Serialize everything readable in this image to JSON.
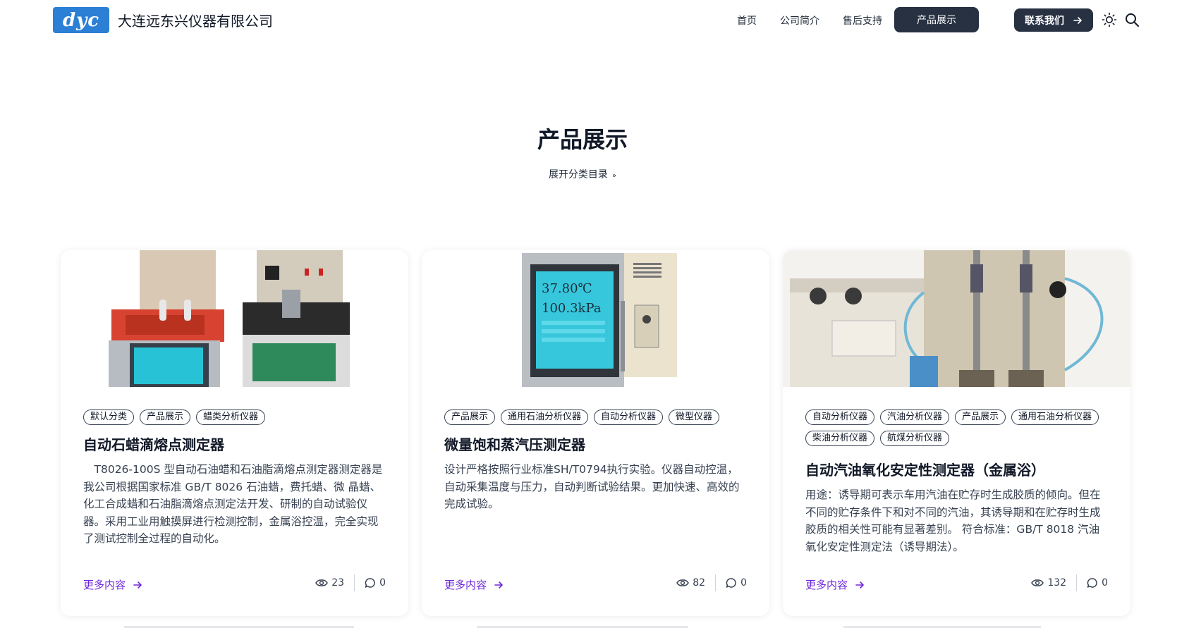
{
  "header": {
    "logo_text": "dyc",
    "site_name": "大连远东兴仪器有限公司",
    "nav": {
      "home": "首页",
      "about": "公司简介",
      "support": "售后支持",
      "products": "产品展示",
      "contact": "联系我们"
    },
    "icons": [
      "arrow-right-icon",
      "sun-icon",
      "search-icon"
    ]
  },
  "main": {
    "title": "产品展示",
    "expand_label": "展开分类目录"
  },
  "cards": [
    {
      "tags": [
        "默认分类",
        "产品展示",
        "蜡类分析仪器"
      ],
      "title": "自动石蜡滴熔点测定器",
      "description": "　T8026-100S 型自动石油蜡和石油脂滴熔点测定器测定器是我公司根据国家标准 GB/T 8026 石油蜡，费托蜡、微 晶蜡、化工合成蜡和石油脂滴熔点测定法开发、研制的自动试验仪器。采用工业用触摸屏进行检测控制，金属浴控温，完全实现了测试控制全过程的自动化。",
      "more": "更多内容",
      "views": "23",
      "comments": "0"
    },
    {
      "tags": [
        "产品展示",
        "通用石油分析仪器",
        "自动分析仪器",
        "微型仪器"
      ],
      "title": "微量饱和蒸汽压测定器",
      "description": "设计严格按照行业标准SH/T0794执行实验。仪器自动控温，自动采集温度与压力，自动判断试验结果。更加快速、高效的完成试验。",
      "more": "更多内容",
      "views": "82",
      "comments": "0",
      "screen_text_1": "37.80℃",
      "screen_text_2": "100.3kPa"
    },
    {
      "tags": [
        "自动分析仪器",
        "汽油分析仪器",
        "产品展示",
        "通用石油分析仪器",
        "柴油分析仪器",
        "航煤分析仪器"
      ],
      "title": "自动汽油氧化安定性测定器（金属浴）",
      "description": "用途：诱导期可表示车用汽油在贮存时生成胶质的倾向。但在不同的贮存条件下和对不同的汽油，其诱导期和在贮存时生成胶质的相关性可能有显著差别。 符合标准：GB/T 8018 汽油氧化安定性测定法（诱导期法）。",
      "more": "更多内容",
      "views": "132",
      "comments": "0"
    }
  ],
  "colors": {
    "nav_dark": "#273142",
    "link_purple": "#6d28d9",
    "logo_blue": "#2b7fd4"
  }
}
